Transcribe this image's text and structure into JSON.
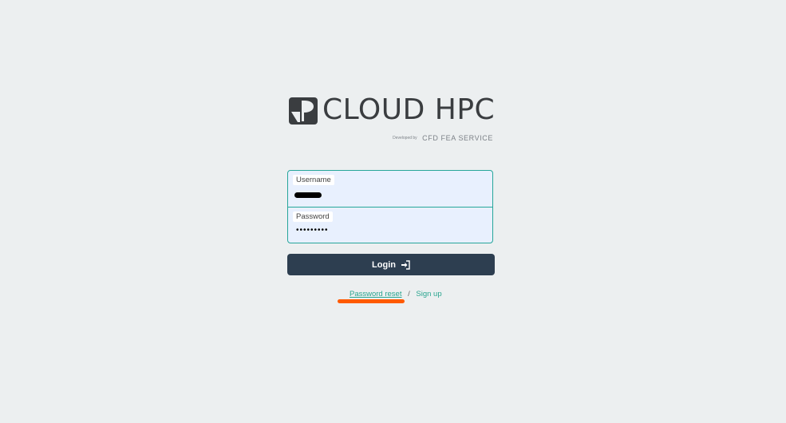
{
  "logo": {
    "title": "CLOUD HPC",
    "developed_by": "Developed by",
    "service": "CFD FEA SERVICE"
  },
  "form": {
    "username_label": "Username",
    "username_value": "",
    "password_label": "Password",
    "password_value": "•••••••••",
    "login_label": "Login"
  },
  "links": {
    "password_reset": "Password reset",
    "separator": "/",
    "sign_up": "Sign up"
  },
  "colors": {
    "accent": "#26a69a",
    "button": "#2d3e50",
    "annotation": "#ff5a00"
  },
  "icons": {
    "logo": "cloud-hpc-logo-icon",
    "login": "sign-in-icon"
  }
}
